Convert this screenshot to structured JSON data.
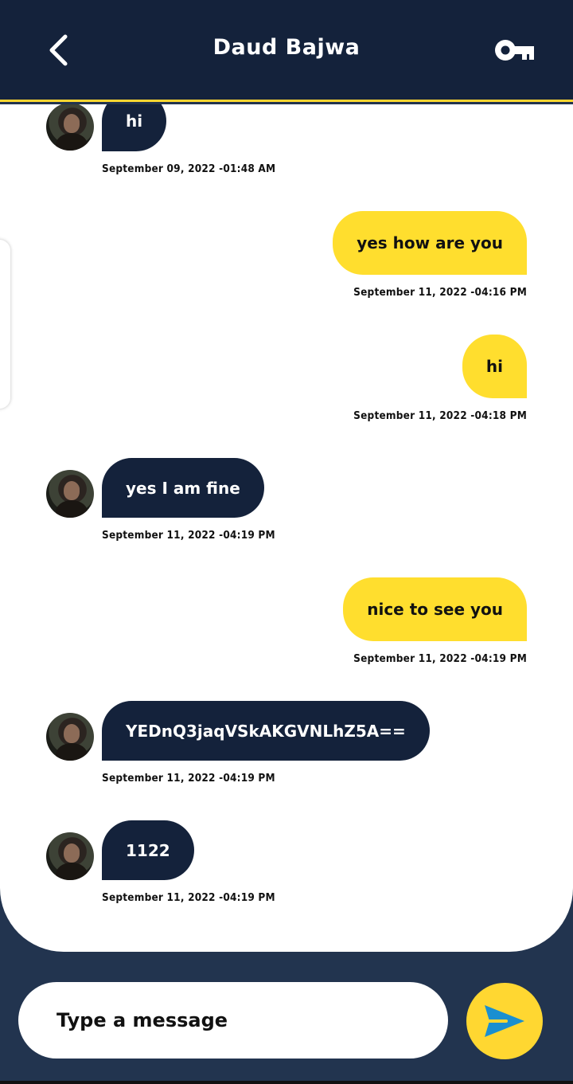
{
  "header": {
    "title": "Daud Bajwa",
    "back_icon": "chevron-left-icon",
    "key_icon": "key-icon"
  },
  "messages": [
    {
      "direction": "in",
      "text": "hi",
      "time": "September 09, 2022 -01:48 AM"
    },
    {
      "direction": "out",
      "text": "yes how are you",
      "time": "September 11, 2022 -04:16 PM"
    },
    {
      "direction": "out",
      "text": "hi",
      "time": "September 11, 2022 -04:18 PM"
    },
    {
      "direction": "in",
      "text": "yes I am fine",
      "time": "September 11, 2022 -04:19 PM"
    },
    {
      "direction": "out",
      "text": "nice to see you",
      "time": "September 11, 2022 -04:19 PM"
    },
    {
      "direction": "in",
      "text": "YEDnQ3jaqVSkAKGVNLhZ5A==",
      "time": "September 11, 2022 -04:19 PM"
    },
    {
      "direction": "in",
      "text": "1122",
      "time": "September 11, 2022 -04:19 PM"
    }
  ],
  "composer": {
    "placeholder": "Type a message",
    "send_icon": "send-icon"
  },
  "colors": {
    "header_bg": "#14223b",
    "app_bg": "#22344f",
    "incoming_bubble": "#14223b",
    "outgoing_bubble": "#ffde2e",
    "accent": "#ffd731",
    "send_arrow": "#1a8fd0"
  }
}
